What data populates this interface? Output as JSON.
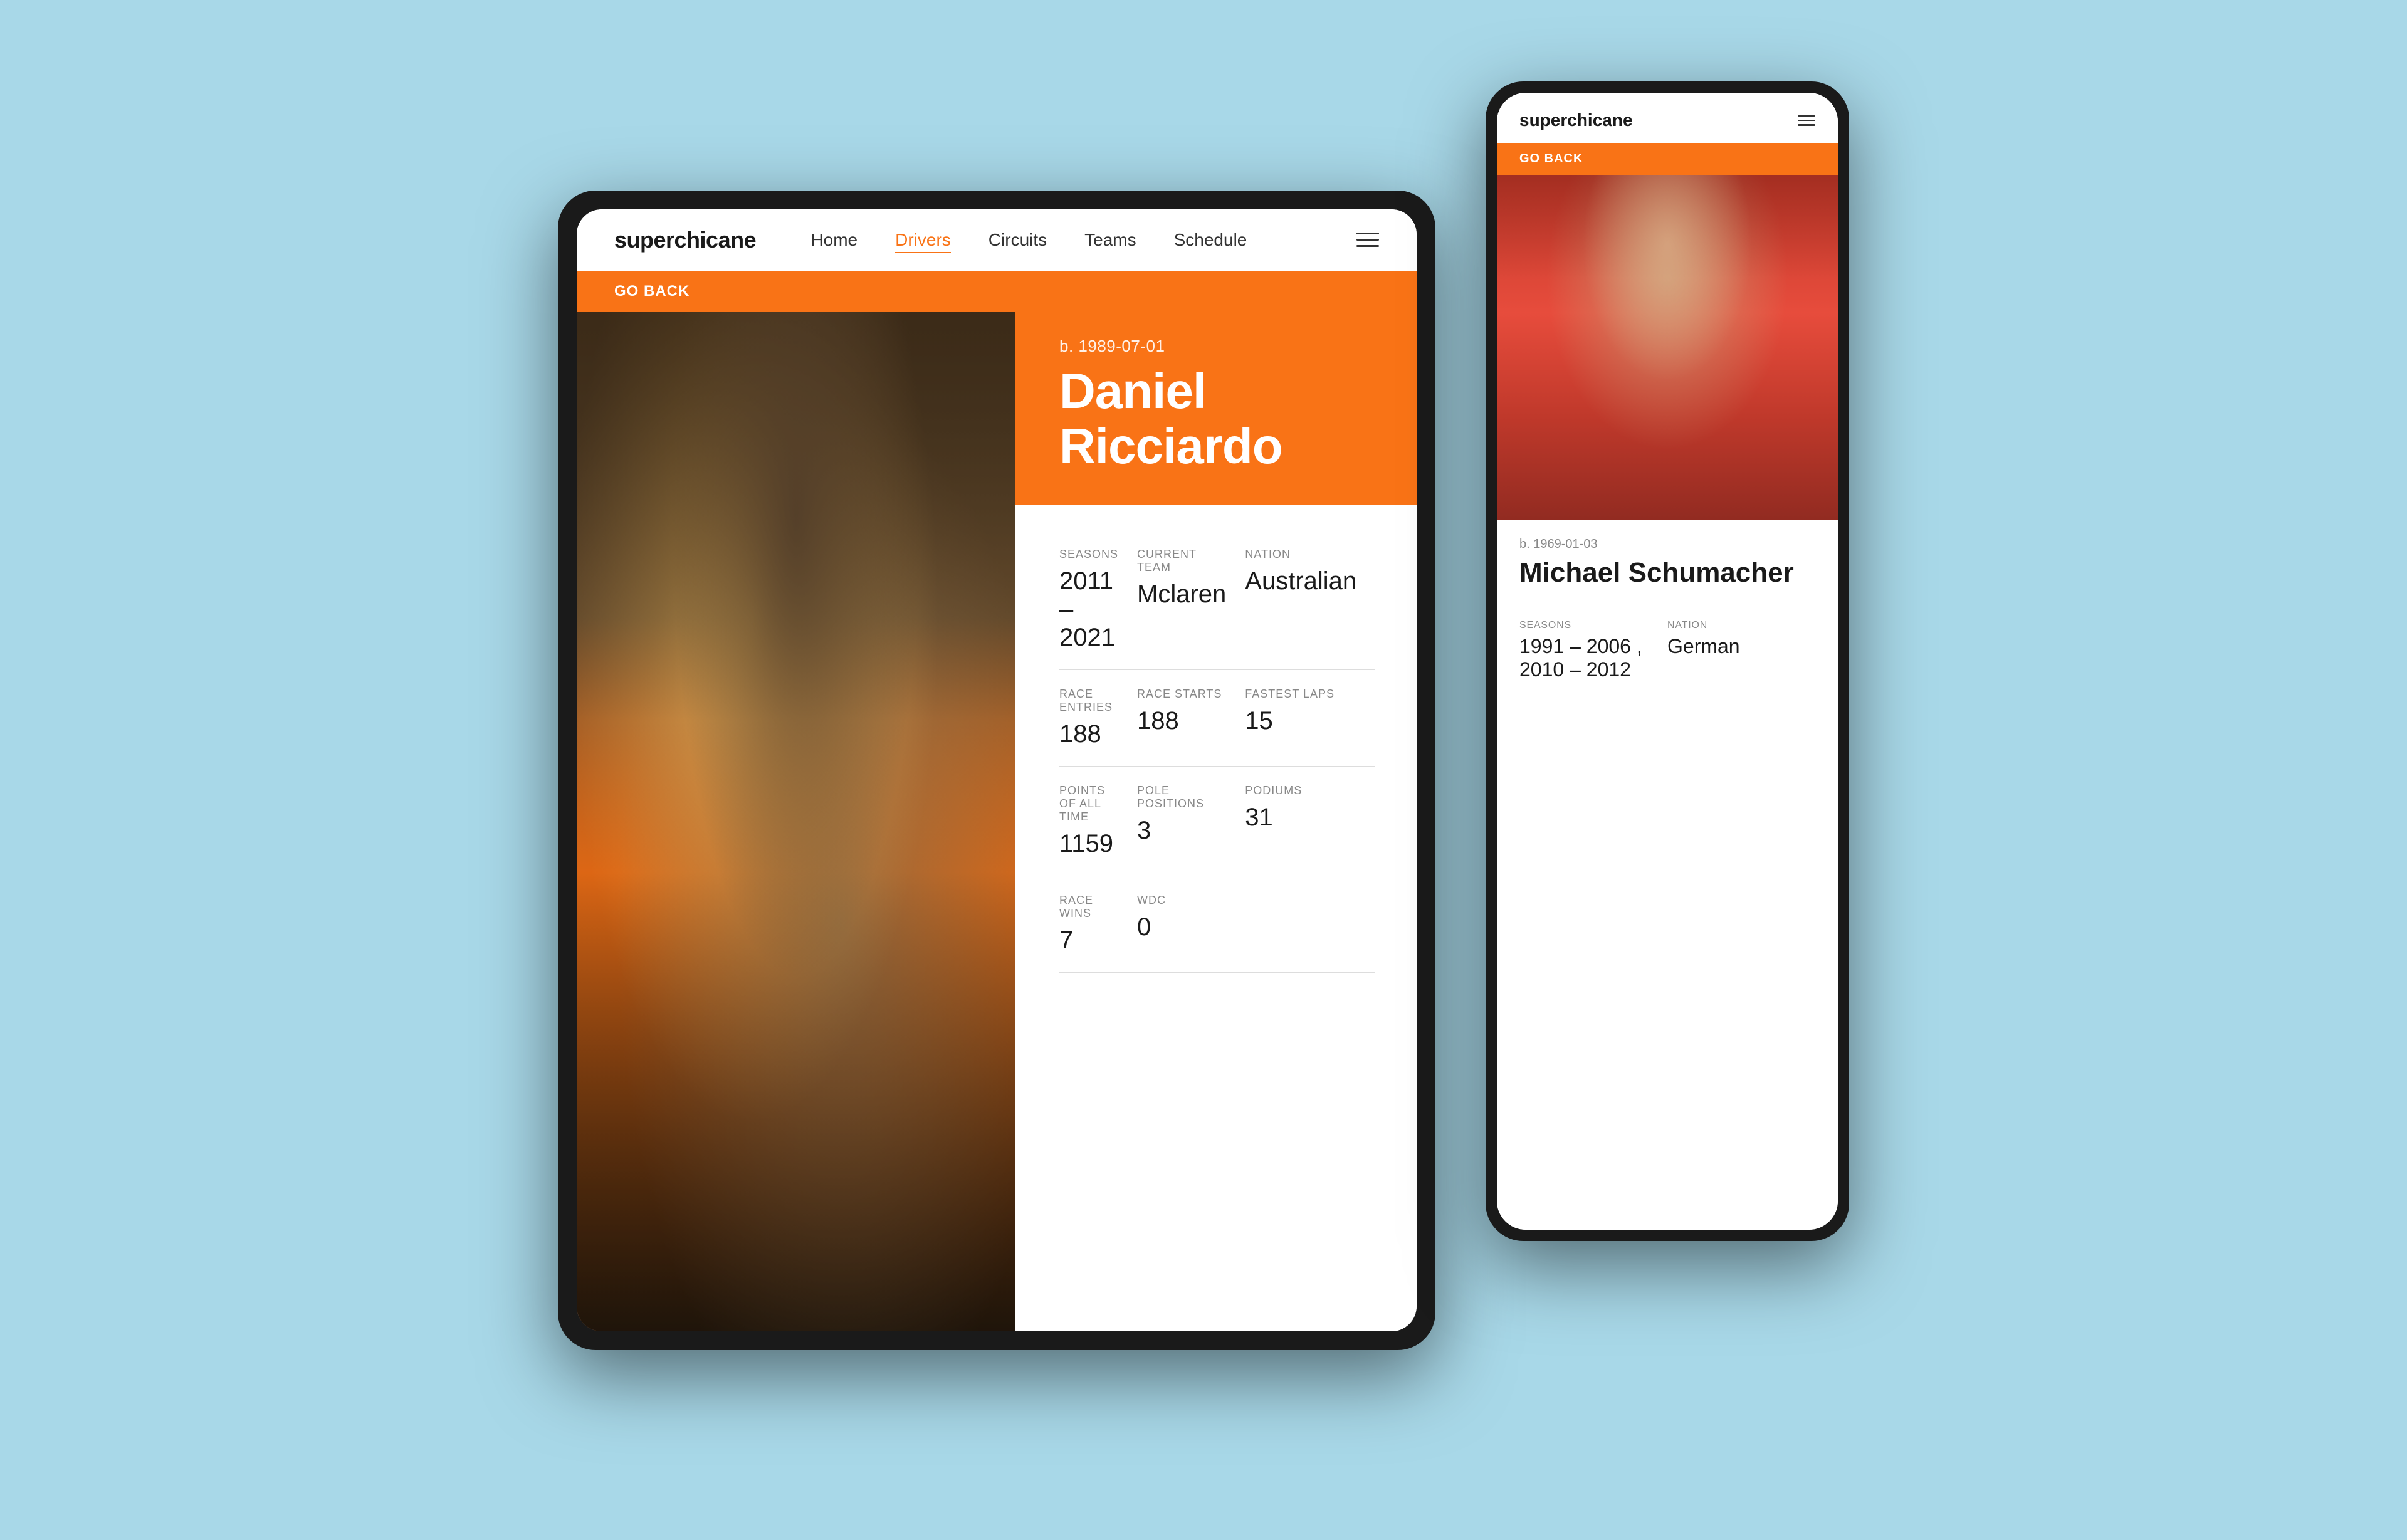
{
  "app": {
    "brand": "superchicane"
  },
  "tablet": {
    "nav": {
      "brand": "superchicane",
      "links": [
        {
          "label": "Home",
          "active": false
        },
        {
          "label": "Drivers",
          "active": true
        },
        {
          "label": "Circuits",
          "active": false
        },
        {
          "label": "Teams",
          "active": false
        },
        {
          "label": "Schedule",
          "active": false
        }
      ]
    },
    "go_back": "GO BACK",
    "driver": {
      "dob": "b. 1989-07-01",
      "name": "Daniel Ricciardo",
      "stats": [
        {
          "label": "SEASONS",
          "value": "2011 – 2021"
        },
        {
          "label": "CURRENT TEAM",
          "value": "Mclaren"
        },
        {
          "label": "NATION",
          "value": "Australian"
        },
        {
          "label": "RACE ENTRIES",
          "value": "188"
        },
        {
          "label": "RACE STARTS",
          "value": "188"
        },
        {
          "label": "FASTEST LAPS",
          "value": "15"
        },
        {
          "label": "POINTS OF ALL TIME",
          "value": "1159"
        },
        {
          "label": "POLE POSITIONS",
          "value": "3"
        },
        {
          "label": "PODIUMS",
          "value": "31"
        },
        {
          "label": "RACE WINS",
          "value": "7"
        },
        {
          "label": "WDC",
          "value": "0"
        },
        {
          "label": "",
          "value": ""
        }
      ]
    }
  },
  "phone": {
    "nav": {
      "brand": "superchicane"
    },
    "go_back": "GO BACK",
    "driver": {
      "dob": "b. 1969-01-03",
      "name": "Michael Schumacher",
      "stats": [
        {
          "label": "SEASONS",
          "value": "1991 – 2006 ,\n2010 – 2012"
        },
        {
          "label": "NATION",
          "value": "German"
        }
      ]
    }
  }
}
